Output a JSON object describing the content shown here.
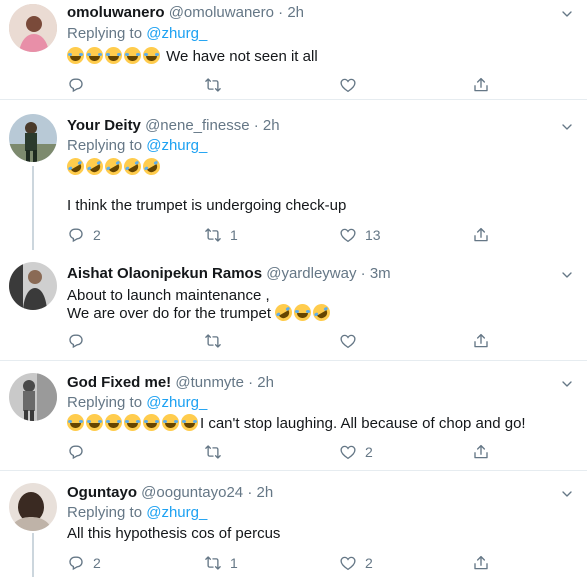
{
  "tweets": [
    {
      "name": "omoluwanero",
      "handle": "@omoluwanero",
      "time": "2h",
      "replying_prefix": "Replying to ",
      "replying_to": "@zhurg_",
      "emoji_count": 5,
      "emoji_kind": "joy",
      "text_after_emoji": "We have not seen it all",
      "lines": [],
      "reply_count": "",
      "retweet_count": "",
      "like_count": "",
      "avatar_colors": [
        "#d9c2b8",
        "#7a4a3a",
        "#e88fa8"
      ]
    },
    {
      "name": "Your Deity",
      "handle": "@nene_finesse",
      "time": "2h",
      "replying_prefix": "Replying to ",
      "replying_to": "@zhurg_",
      "emoji_count": 5,
      "emoji_kind": "rofl",
      "text_after_emoji": "",
      "lines": [
        "I think the trumpet is undergoing check-up"
      ],
      "reply_count": "2",
      "retweet_count": "1",
      "like_count": "13",
      "avatar_colors": [
        "#b8c9d6",
        "#2b3b2e",
        "#4a3a2a"
      ]
    },
    {
      "name": "Aishat Olaonipekun Ramos",
      "handle": "@yardleyway",
      "time": "3m",
      "replying_prefix": "",
      "replying_to": "",
      "lines": [
        "About to launch maintenance ,",
        "We are over do for the trumpet"
      ],
      "reply_count": "",
      "retweet_count": "",
      "like_count": "",
      "avatar_colors": [
        "#3a3a3a",
        "#8a6a55",
        "#cfcfcf"
      ]
    },
    {
      "name": "God Fixed me!",
      "handle": "@tunmyte",
      "time": "2h",
      "replying_prefix": "Replying to ",
      "replying_to": "@zhurg_",
      "emoji_count": 7,
      "emoji_kind": "joy",
      "text_after_emoji": "I can't stop laughing. All because of chop and go!",
      "lines": [],
      "reply_count": "",
      "retweet_count": "",
      "like_count": "2",
      "avatar_colors": [
        "#c9c9c9",
        "#4a4a4a",
        "#9a9a9a"
      ]
    },
    {
      "name": "Oguntayo",
      "handle": "@ooguntayo24",
      "time": "2h",
      "replying_prefix": "Replying to ",
      "replying_to": "@zhurg_",
      "lines": [
        "All this hypothesis cos of percus"
      ],
      "reply_count": "2",
      "retweet_count": "1",
      "like_count": "2",
      "avatar_colors": [
        "#e8e0da",
        "#3a2a22",
        "#bfb3a8"
      ]
    }
  ],
  "separator_dot": "·",
  "icons": {
    "reply": "reply-icon",
    "retweet": "retweet-icon",
    "like": "heart-icon",
    "share": "share-icon",
    "more": "chevron-down-icon"
  }
}
